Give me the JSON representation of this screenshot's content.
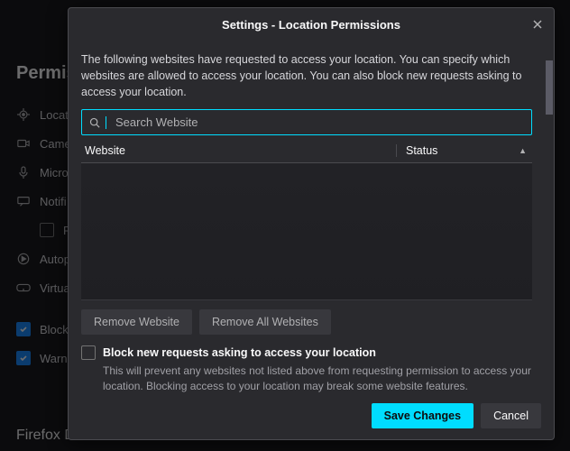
{
  "background": {
    "section_heading": "Permissi",
    "items": [
      {
        "label": "Locat"
      },
      {
        "label": "Came"
      },
      {
        "label": "Micro"
      },
      {
        "label": "Notifi"
      },
      {
        "label": "Pau",
        "indent": true
      },
      {
        "label": "Autop"
      },
      {
        "label": "Virtua"
      }
    ],
    "checkbox_block": "Block",
    "checkbox_warn": "Warn",
    "footer_truncated": "Firefox Data Collection and Use"
  },
  "dialog": {
    "title": "Settings - Location Permissions",
    "description": "The following websites have requested to access your location. You can specify which websites are allowed to access your location. You can also block new requests asking to access your location.",
    "search_placeholder": "Search Website",
    "columns": {
      "website": "Website",
      "status": "Status"
    },
    "remove_website": "Remove Website",
    "remove_all": "Remove All Websites",
    "block_checkbox_label": "Block new requests asking to access your location",
    "block_checkbox_desc": "This will prevent any websites not listed above from requesting permission to access your location. Blocking access to your location may break some website features.",
    "save": "Save Changes",
    "cancel": "Cancel"
  }
}
